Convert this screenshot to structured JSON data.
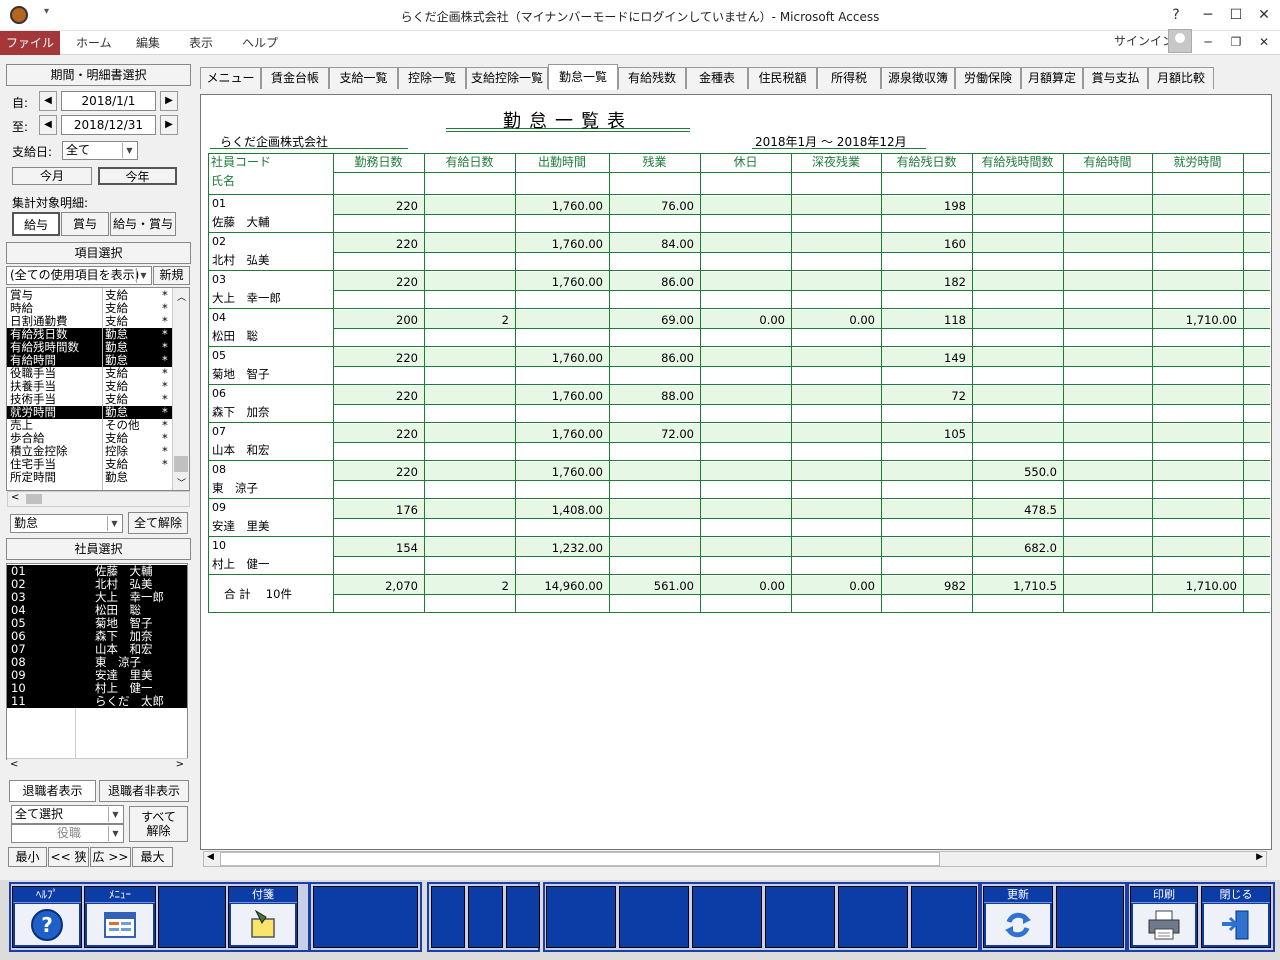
{
  "window": {
    "title": "らくだ企画株式会社（マイナンバーモードにログインしていません）- Microsoft Access",
    "signin": "サインイン"
  },
  "ribbon": {
    "file": "ファイル",
    "tabs": [
      "ホーム",
      "編集",
      "表示",
      "ヘルプ"
    ]
  },
  "left": {
    "period_header": "期間・明細書選択",
    "from_label": "自:",
    "from_date": "2018/1/1",
    "to_label": "至:",
    "to_date": "2018/12/31",
    "payday_label": "支給日:",
    "payday_value": "全て",
    "this_month": "今月",
    "this_year": "今年",
    "target_label": "集計対象明細:",
    "target_buttons": [
      "給与",
      "賞与",
      "給与・賞与"
    ],
    "item_header": "項目選択",
    "item_filter": "(全ての使用項目を表示)",
    "new_button": "新規",
    "items": [
      {
        "name": "賞与",
        "type": "支給",
        "mark": "*",
        "sel": false
      },
      {
        "name": "時給",
        "type": "支給",
        "mark": "*",
        "sel": false
      },
      {
        "name": "日割通勤費",
        "type": "支給",
        "mark": "*",
        "sel": false
      },
      {
        "name": "有給残日数",
        "type": "勤怠",
        "mark": "*",
        "sel": true
      },
      {
        "name": "有給残時間数",
        "type": "勤怠",
        "mark": "*",
        "sel": true
      },
      {
        "name": "有給時間",
        "type": "勤怠",
        "mark": "*",
        "sel": true
      },
      {
        "name": "役職手当",
        "type": "支給",
        "mark": "*",
        "sel": false
      },
      {
        "name": "扶養手当",
        "type": "支給",
        "mark": "*",
        "sel": false
      },
      {
        "name": "技術手当",
        "type": "支給",
        "mark": "*",
        "sel": false
      },
      {
        "name": "就労時間",
        "type": "勤怠",
        "mark": "*",
        "sel": true
      },
      {
        "name": "売上",
        "type": "その他",
        "mark": "*",
        "sel": false
      },
      {
        "name": "歩合給",
        "type": "支給",
        "mark": "*",
        "sel": false
      },
      {
        "name": "積立金控除",
        "type": "控除",
        "mark": "*",
        "sel": false
      },
      {
        "name": "住宅手当",
        "type": "支給",
        "mark": "*",
        "sel": false
      },
      {
        "name": "所定時間",
        "type": "勤怠",
        "mark": "",
        "sel": false
      }
    ],
    "category_value": "勤怠",
    "clear_all": "全て解除",
    "emp_header": "社員選択",
    "employees": [
      {
        "code": "01",
        "name": "佐藤　大輔"
      },
      {
        "code": "02",
        "name": "北村　弘美"
      },
      {
        "code": "03",
        "name": "大上　幸一郎"
      },
      {
        "code": "04",
        "name": "松田　聡"
      },
      {
        "code": "05",
        "name": "菊地　智子"
      },
      {
        "code": "06",
        "name": "森下　加奈"
      },
      {
        "code": "07",
        "name": "山本　和宏"
      },
      {
        "code": "08",
        "name": "東　涼子"
      },
      {
        "code": "09",
        "name": "安達　里美"
      },
      {
        "code": "10",
        "name": "村上　健一"
      },
      {
        "code": "11",
        "name": "らくだ　太郎"
      }
    ],
    "retired_show": "退職者表示",
    "retired_hide": "退職者非表示",
    "select_all": "全て選択",
    "position": "役職",
    "release_all": "すべて\n解除",
    "zoom_min": "最小",
    "zoom_narrow": "<< 狭",
    "zoom_wide": "広 >>",
    "zoom_max": "最大"
  },
  "tabs": [
    "メニュー",
    "賃金台帳",
    "支給一覧",
    "控除一覧",
    "支給控除一覧",
    "勤怠一覧",
    "有給残数",
    "金種表",
    "住民税額",
    "所得税",
    "源泉徴収簿",
    "労働保険",
    "月額算定",
    "賞与支払",
    "月額比較"
  ],
  "active_tab": 5,
  "report": {
    "title": "勤怠一覧表",
    "company": "らくだ企画株式会社",
    "period": "2018年1月 ～ 2018年12月",
    "code_header": "社員コード",
    "name_header": "氏名",
    "columns": [
      "勤務日数",
      "有給日数",
      "出勤時間",
      "残業",
      "休日",
      "深夜残業",
      "有給残日数",
      "有給残時間数",
      "有給時間",
      "就労時間"
    ],
    "rows": [
      {
        "code": "01",
        "name": "佐藤　大輔",
        "vals": [
          "220",
          "",
          "1,760.00",
          "76.00",
          "",
          "",
          "198",
          "",
          "",
          ""
        ]
      },
      {
        "code": "02",
        "name": "北村　弘美",
        "vals": [
          "220",
          "",
          "1,760.00",
          "84.00",
          "",
          "",
          "160",
          "",
          "",
          ""
        ]
      },
      {
        "code": "03",
        "name": "大上　幸一郎",
        "vals": [
          "220",
          "",
          "1,760.00",
          "86.00",
          "",
          "",
          "182",
          "",
          "",
          ""
        ]
      },
      {
        "code": "04",
        "name": "松田　聡",
        "vals": [
          "200",
          "2",
          "",
          "69.00",
          "0.00",
          "0.00",
          "118",
          "",
          "",
          "1,710.00"
        ]
      },
      {
        "code": "05",
        "name": "菊地　智子",
        "vals": [
          "220",
          "",
          "1,760.00",
          "86.00",
          "",
          "",
          "149",
          "",
          "",
          ""
        ]
      },
      {
        "code": "06",
        "name": "森下　加奈",
        "vals": [
          "220",
          "",
          "1,760.00",
          "88.00",
          "",
          "",
          "72",
          "",
          "",
          ""
        ]
      },
      {
        "code": "07",
        "name": "山本　和宏",
        "vals": [
          "220",
          "",
          "1,760.00",
          "72.00",
          "",
          "",
          "105",
          "",
          "",
          ""
        ]
      },
      {
        "code": "08",
        "name": "東　涼子",
        "vals": [
          "220",
          "",
          "1,760.00",
          "",
          "",
          "",
          "",
          "550.0",
          "",
          ""
        ]
      },
      {
        "code": "09",
        "name": "安達　里美",
        "vals": [
          "176",
          "",
          "1,408.00",
          "",
          "",
          "",
          "",
          "478.5",
          "",
          ""
        ]
      },
      {
        "code": "10",
        "name": "村上　健一",
        "vals": [
          "154",
          "",
          "1,232.00",
          "",
          "",
          "",
          "",
          "682.0",
          "",
          ""
        ]
      }
    ],
    "total_label": "合 計　 10件",
    "total_vals": [
      "2,070",
      "2",
      "14,960.00",
      "561.00",
      "0.00",
      "0.00",
      "982",
      "1,710.5",
      "",
      "1,710.00"
    ]
  },
  "fkeys": [
    {
      "label": "ﾍﾙﾌﾟ",
      "icon": "help-icon"
    },
    {
      "label": "ﾒﾆｭｰ",
      "icon": "menu-icon"
    },
    {
      "label": "",
      "icon": ""
    },
    {
      "label": "付箋",
      "icon": "sticky-note-icon"
    },
    {
      "label": "更新",
      "icon": "refresh-icon"
    },
    {
      "label": "印刷",
      "icon": "printer-icon"
    },
    {
      "label": "閉じる",
      "icon": "exit-door-icon"
    }
  ],
  "colors": {
    "accent_green": "#1e7b3a",
    "row_fill": "#e6f7e6",
    "file_tab": "#a4373a",
    "fkey_blue": "#0c3ca6"
  }
}
